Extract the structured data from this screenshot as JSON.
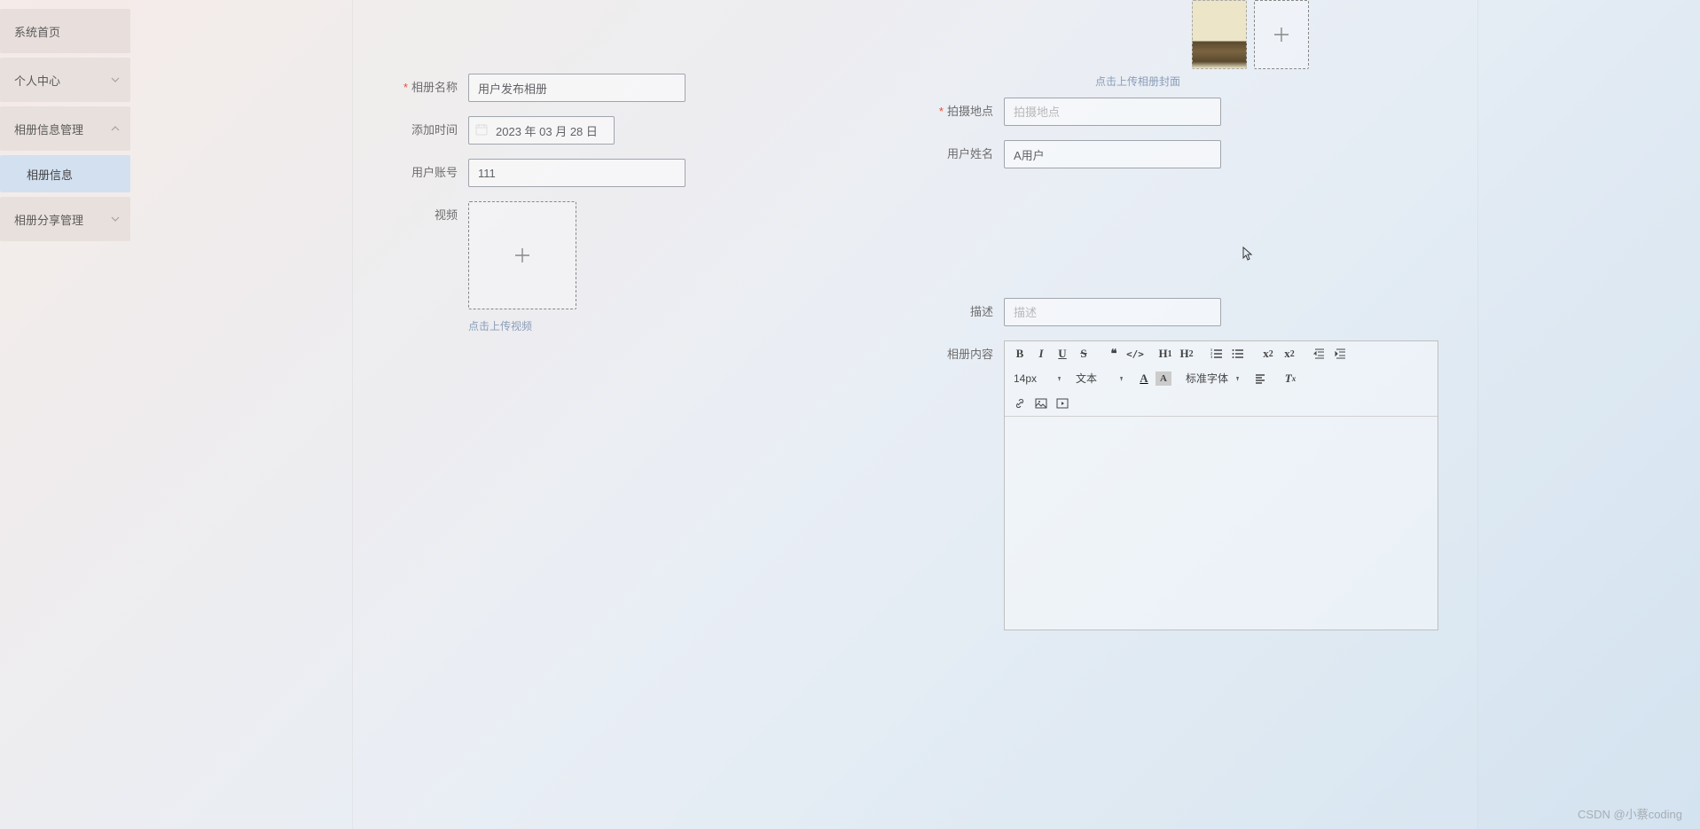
{
  "sidebar": {
    "items": [
      {
        "label": "系统首页",
        "hasChildren": false
      },
      {
        "label": "个人中心",
        "hasChildren": true,
        "expanded": false
      },
      {
        "label": "相册信息管理",
        "hasChildren": true,
        "expanded": true
      },
      {
        "label": "相册信息",
        "isSub": true
      },
      {
        "label": "相册分享管理",
        "hasChildren": true,
        "expanded": false
      }
    ]
  },
  "form": {
    "albumNameLabel": "相册名称",
    "albumNameValue": "用户发布相册",
    "addTimeLabel": "添加时间",
    "addTimeValue": "2023 年 03 月 28 日",
    "userAccountLabel": "用户账号",
    "userAccountValue": "111",
    "videoLabel": "视频",
    "videoHint": "点击上传视频",
    "coverHint": "点击上传相册封面",
    "shootLocationLabel": "拍摄地点",
    "shootLocationPlaceholder": "拍摄地点",
    "userNameLabel": "用户姓名",
    "userNameValue": "A用户",
    "descLabel": "描述",
    "descPlaceholder": "描述",
    "contentLabel": "相册内容"
  },
  "editor": {
    "fontSizeValue": "14px",
    "textTypeValue": "文本",
    "fontFamilyValue": "标准字体"
  },
  "watermark": "CSDN @小蔡coding"
}
